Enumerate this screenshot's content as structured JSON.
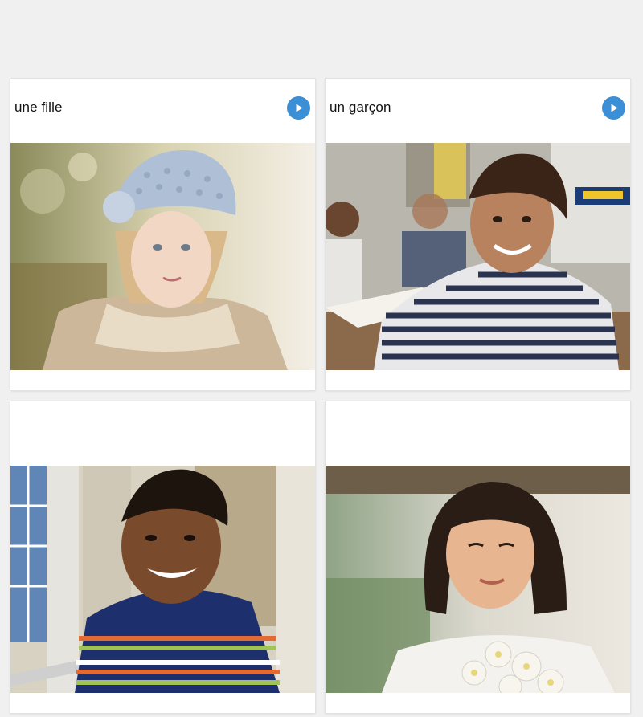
{
  "cards": [
    {
      "label": "une fille",
      "play_icon": "play-icon",
      "photo": "girl-in-knit-hat-photo"
    },
    {
      "label": "un garçon",
      "play_icon": "play-icon",
      "photo": "boy-in-classroom-photo"
    },
    {
      "label": "",
      "photo": "smiling-boy-striped-shirt-photo"
    },
    {
      "label": "",
      "photo": "girl-with-flowers-photo"
    }
  ],
  "colors": {
    "page_background": "#f0f0f0",
    "card_background": "#ffffff",
    "play_button": "#3a8fd6"
  }
}
